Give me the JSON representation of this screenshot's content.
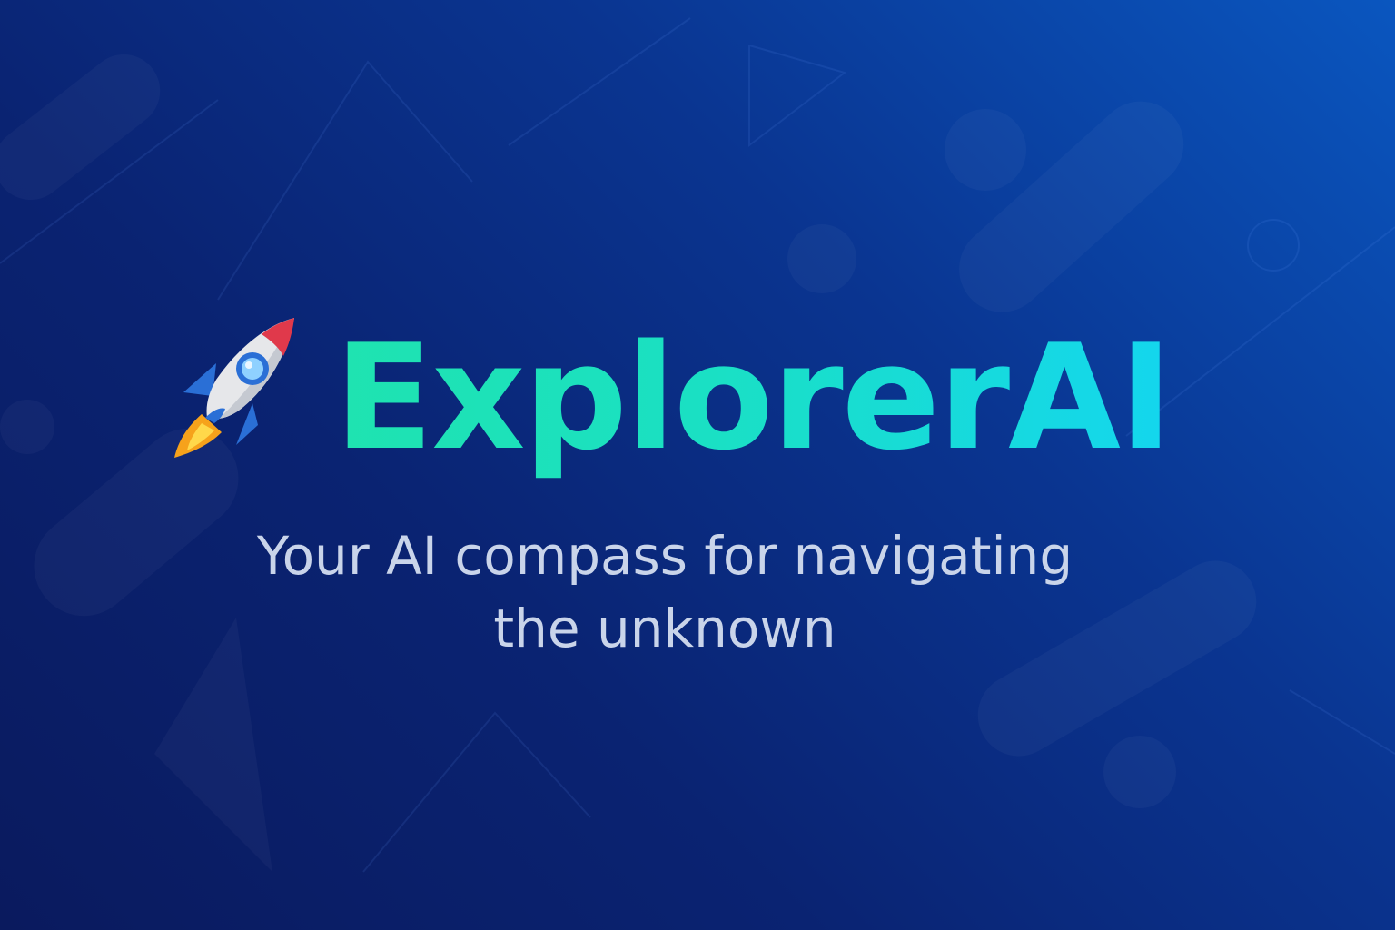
{
  "brand": {
    "name": "ExplorerAI",
    "logo_icon": "rocket-icon"
  },
  "tagline": {
    "line1": "Your AI compass for navigating",
    "line2": "the unknown"
  },
  "colors": {
    "background_start": "#0a1a5e",
    "background_end": "#0a56bf",
    "title_gradient_start": "#1fe3b0",
    "title_gradient_end": "#14d6ee",
    "tagline_text": "#c9d4ea"
  }
}
